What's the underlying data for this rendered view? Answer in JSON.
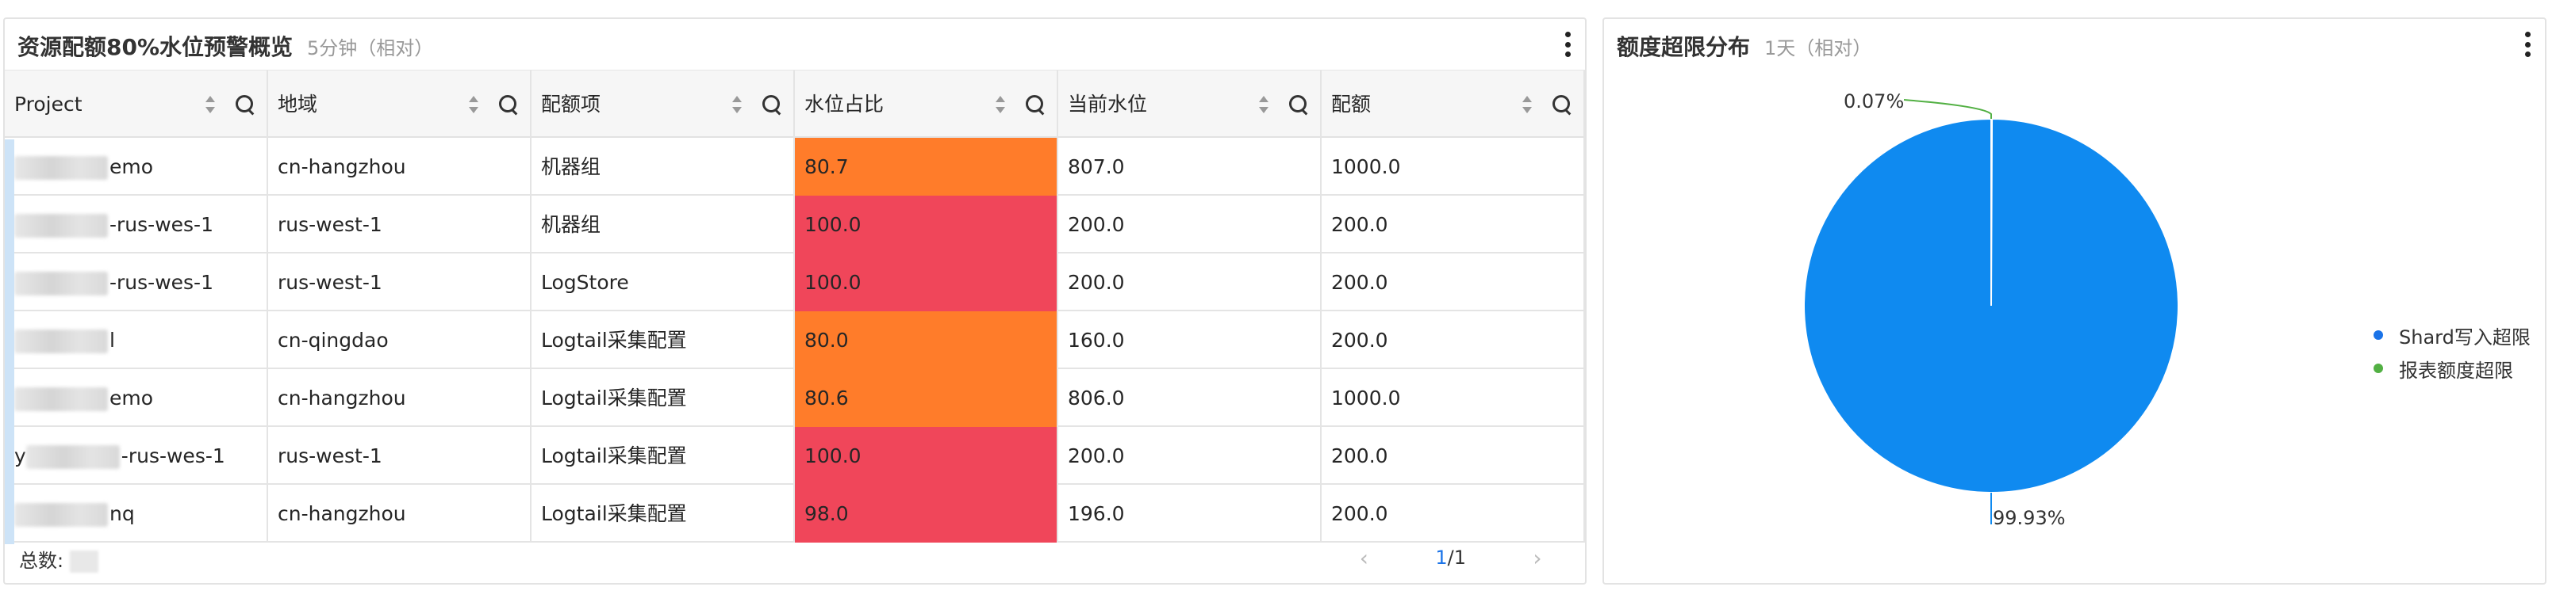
{
  "left_panel": {
    "title": "资源配额80%水位预警概览",
    "time_range": "5分钟（相对）",
    "columns": [
      "Project",
      "地域",
      "配额项",
      "水位占比",
      "当前水位",
      "配额"
    ],
    "rows": [
      {
        "project_suffix": "emo",
        "region": "cn-hangzhou",
        "item": "机器组",
        "ratio": "80.7",
        "ratio_level": "warn",
        "current": "807.0",
        "quota": "1000.0"
      },
      {
        "project_suffix": "-rus-wes-1",
        "region": "rus-west-1",
        "item": "机器组",
        "ratio": "100.0",
        "ratio_level": "alert",
        "current": "200.0",
        "quota": "200.0"
      },
      {
        "project_suffix": "-rus-wes-1",
        "region": "rus-west-1",
        "item": "LogStore",
        "ratio": "100.0",
        "ratio_level": "alert",
        "current": "200.0",
        "quota": "200.0"
      },
      {
        "project_suffix": "l",
        "region": "cn-qingdao",
        "item": "Logtail采集配置",
        "ratio": "80.0",
        "ratio_level": "warn",
        "current": "160.0",
        "quota": "200.0"
      },
      {
        "project_suffix": "emo",
        "region": "cn-hangzhou",
        "item": "Logtail采集配置",
        "ratio": "80.6",
        "ratio_level": "warn",
        "current": "806.0",
        "quota": "1000.0"
      },
      {
        "project_prefix": "y",
        "project_suffix": "-rus-wes-1",
        "region": "rus-west-1",
        "item": "Logtail采集配置",
        "ratio": "100.0",
        "ratio_level": "alert",
        "current": "200.0",
        "quota": "200.0"
      },
      {
        "project_suffix": "nq",
        "region": "cn-hangzhou",
        "item": "Logtail采集配置",
        "ratio": "98.0",
        "ratio_level": "alert",
        "current": "196.0",
        "quota": "200.0"
      }
    ],
    "footer": {
      "total_label": "总数:",
      "page_current": "1",
      "page_total": "/1"
    }
  },
  "right_panel": {
    "title": "额度超限分布",
    "time_range": "1天（相对）",
    "legend": [
      {
        "label": "Shard写入超限",
        "color": "#1a73e8"
      },
      {
        "label": "报表额度超限",
        "color": "#52b043"
      }
    ]
  },
  "chart_data": {
    "type": "pie",
    "labels": [
      "Shard写入超限",
      "报表额度超限"
    ],
    "values": [
      99.93,
      0.07
    ],
    "data_labels": [
      "99.93%",
      "0.07%"
    ],
    "colors": [
      "#0f8af0",
      "#52b043"
    ],
    "legend_position": "right"
  },
  "colors": {
    "warn": "#ff7c2a",
    "alert": "#f0465a",
    "accent": "#1a73e8"
  }
}
